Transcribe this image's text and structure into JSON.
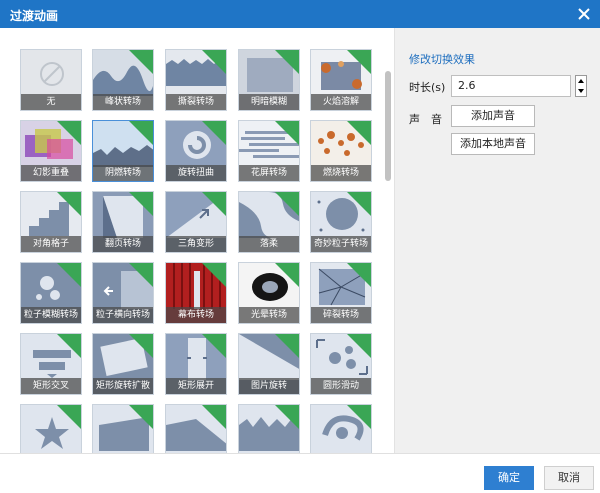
{
  "window": {
    "title": "过渡动画",
    "close_icon": "close-icon"
  },
  "gallery": {
    "new_badge": "NEW",
    "rows": [
      [
        "无",
        "峰状转场",
        "撕裂转场",
        "明暗模糊",
        "火焰溶解"
      ],
      [
        "幻影重叠",
        "阴燃转场",
        "旋转扭曲",
        "花屏转场",
        "燃烧转场"
      ],
      [
        "对角格子",
        "翻页转场",
        "三角变形",
        "落柔",
        "奇妙粒子转场"
      ],
      [
        "粒子模糊转场",
        "粒子横向转场",
        "幕布转场",
        "光晕转场",
        "碎裂转场"
      ],
      [
        "矩形交叉",
        "矩形旋转扩散",
        "矩形展开",
        "图片旋转",
        "圆形滑动"
      ]
    ],
    "selected": "阴燃转场"
  },
  "panel": {
    "title": "修改切换效果",
    "duration_label": "时长(s)",
    "duration_value": "2.6",
    "sound_label": "声　音",
    "add_sound": "添加声音",
    "add_local_sound": "添加本地声音"
  },
  "footer": {
    "ok": "确定",
    "cancel": "取消"
  },
  "colors": {
    "accent": "#1f75c6",
    "new_badge": "#3aa655",
    "tile": "#7d8fa9"
  }
}
